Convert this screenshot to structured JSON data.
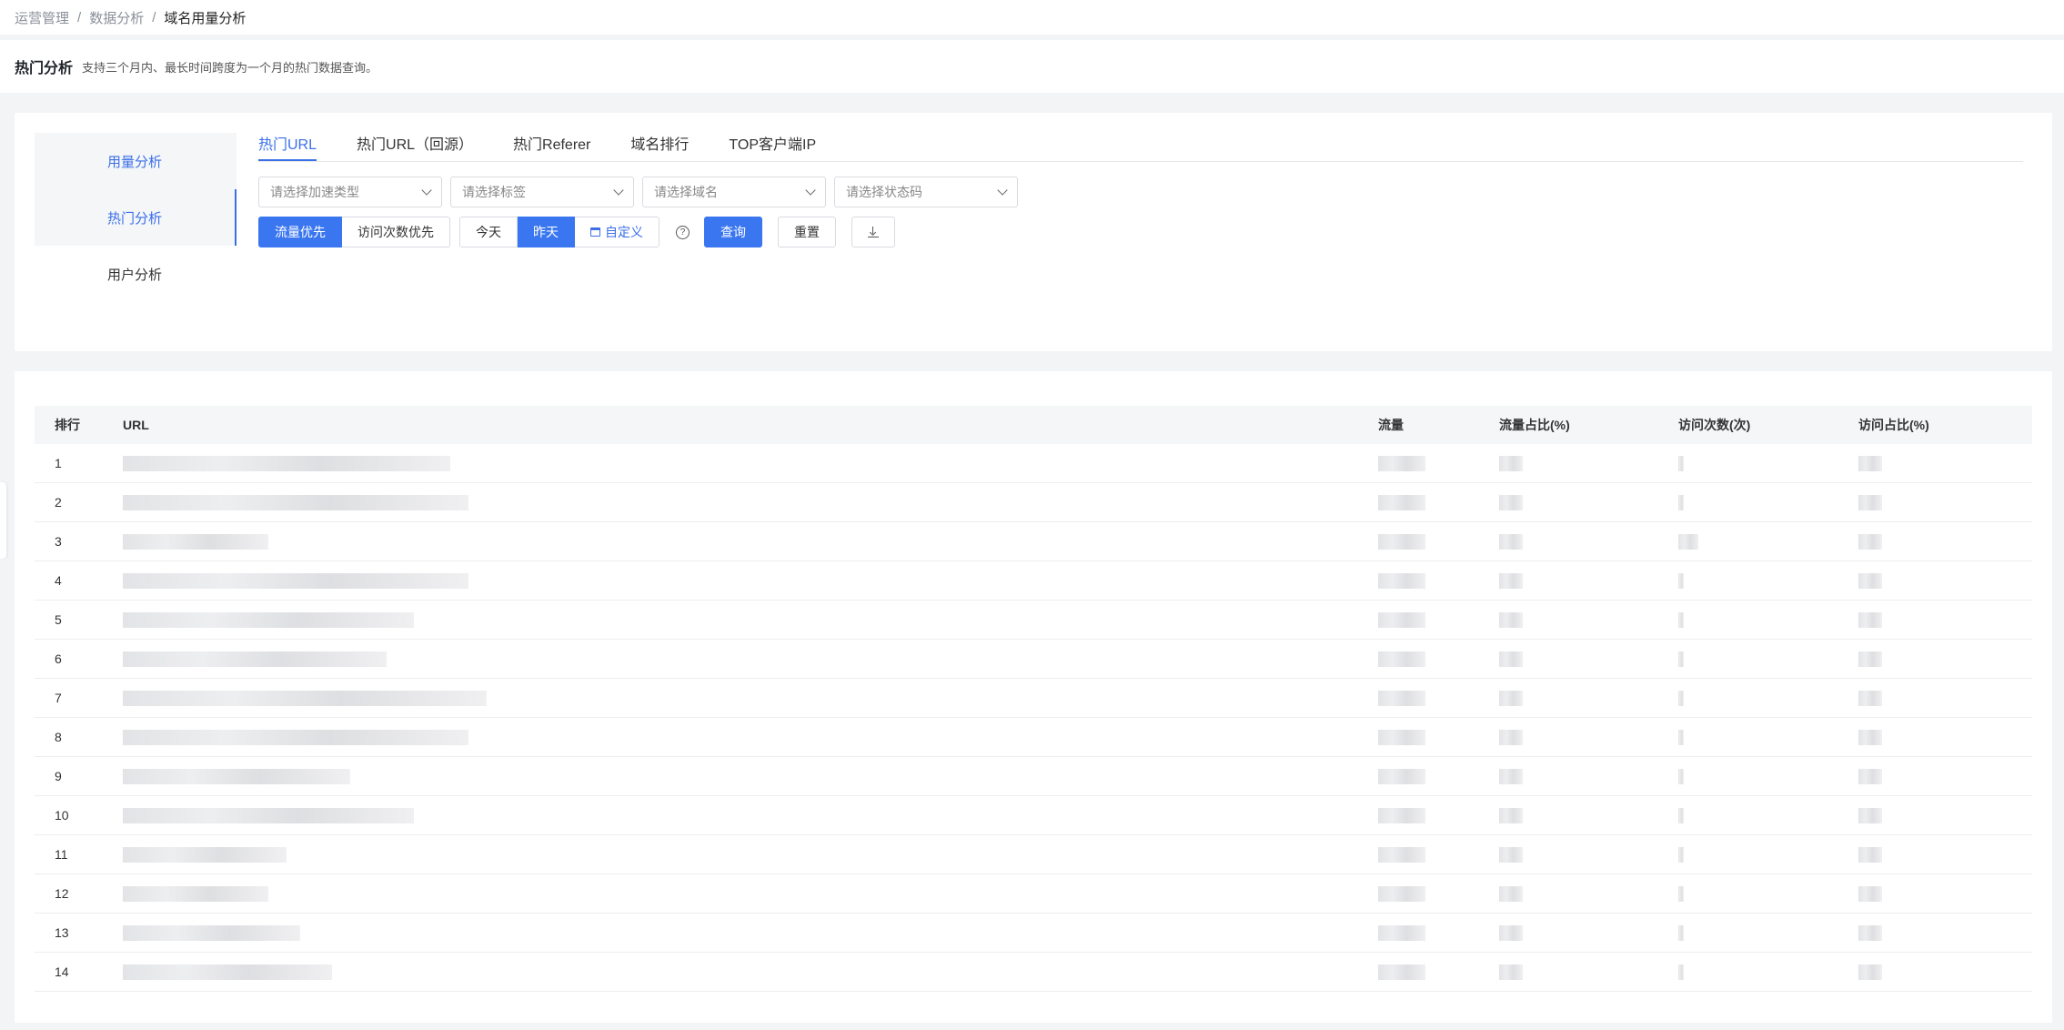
{
  "breadcrumb": {
    "items": [
      "运营管理",
      "数据分析"
    ],
    "separator": "/",
    "current": "域名用量分析"
  },
  "header": {
    "title": "热门分析",
    "description": "支持三个月内、最长时间跨度为一个月的热门数据查询。"
  },
  "sidenav": {
    "items": [
      {
        "label": "用量分析"
      },
      {
        "label": "热门分析"
      },
      {
        "label": "用户分析"
      }
    ]
  },
  "tabs": [
    {
      "label": "热门URL"
    },
    {
      "label": "热门URL（回源）"
    },
    {
      "label": "热门Referer"
    },
    {
      "label": "域名排行"
    },
    {
      "label": "TOP客户端IP"
    }
  ],
  "filters": {
    "accel_type": "请选择加速类型",
    "tag": "请选择标签",
    "domain": "请选择域名",
    "status_code": "请选择状态码"
  },
  "sort": {
    "traffic_first": "流量优先",
    "visits_first": "访问次数优先"
  },
  "dates": {
    "today": "今天",
    "yesterday": "昨天",
    "custom": "自定义"
  },
  "help": "?",
  "buttons": {
    "query": "查询",
    "reset": "重置"
  },
  "table": {
    "columns": {
      "rank": "排行",
      "url": "URL",
      "flow": "流量",
      "flow_pct": "流量占比(%)",
      "visits": "访问次数(次)",
      "visits_pct": "访问占比(%)"
    },
    "rows": [
      {
        "rank": "1"
      },
      {
        "rank": "2"
      },
      {
        "rank": "3"
      },
      {
        "rank": "4"
      },
      {
        "rank": "5"
      },
      {
        "rank": "6"
      },
      {
        "rank": "7"
      },
      {
        "rank": "8"
      },
      {
        "rank": "9"
      },
      {
        "rank": "10"
      },
      {
        "rank": "11"
      },
      {
        "rank": "12"
      },
      {
        "rank": "13"
      },
      {
        "rank": "14"
      }
    ]
  },
  "colors": {
    "accent": "#3a76f0",
    "active_text": "#3a6fe8"
  }
}
